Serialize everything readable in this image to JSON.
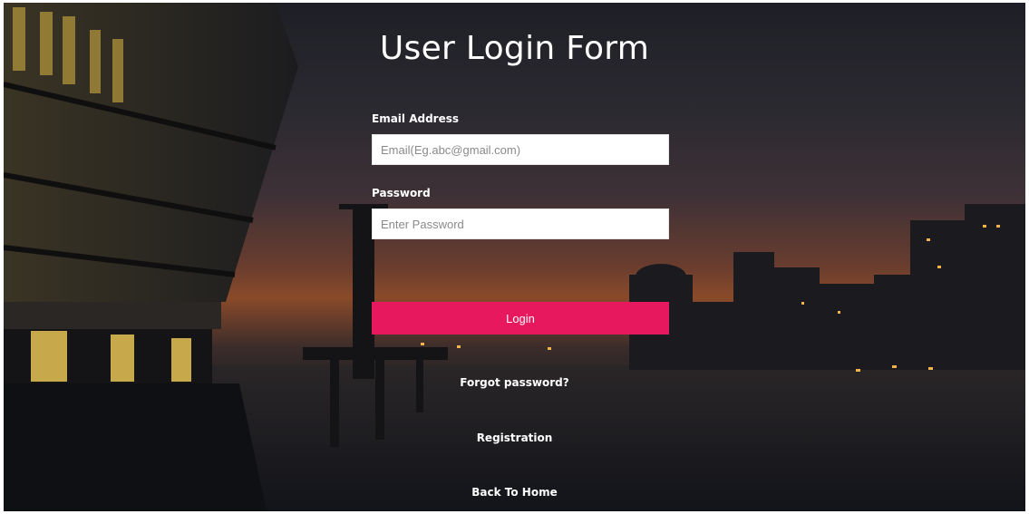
{
  "page": {
    "title": "User Login Form"
  },
  "form": {
    "email_label": "Email Address",
    "email_placeholder": "Email(Eg.abc@gmail.com)",
    "email_value": "",
    "password_label": "Password",
    "password_placeholder": "Enter Password",
    "password_value": "",
    "login_label": "Login"
  },
  "links": {
    "forgot_password": "Forgot password?",
    "registration": "Registration",
    "back_home": "Back To Home"
  },
  "colors": {
    "accent": "#e8185f",
    "text": "#ffffff",
    "input_bg": "#ffffff"
  }
}
